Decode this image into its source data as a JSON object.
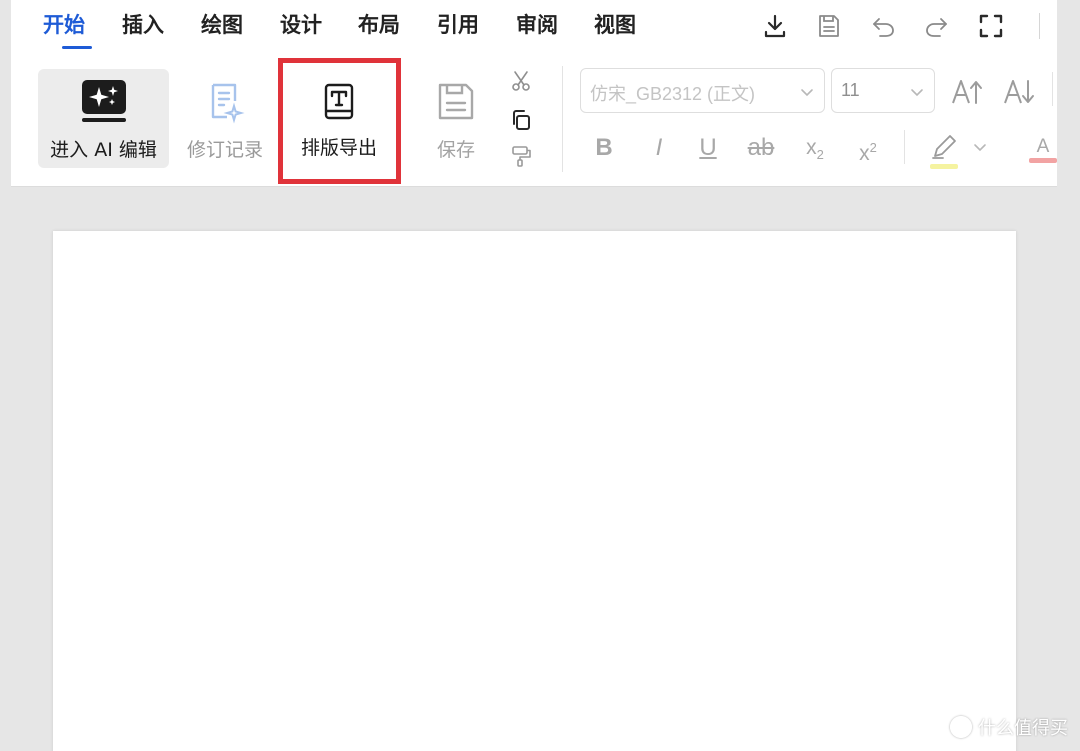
{
  "tabs": [
    {
      "label": "开始",
      "active": true
    },
    {
      "label": "插入"
    },
    {
      "label": "绘图"
    },
    {
      "label": "设计"
    },
    {
      "label": "布局"
    },
    {
      "label": "引用"
    },
    {
      "label": "审阅"
    },
    {
      "label": "视图"
    }
  ],
  "top_icons": [
    "download-icon",
    "save-file-icon",
    "undo-icon",
    "redo-icon",
    "fullscreen-icon"
  ],
  "ribbon": {
    "ai_edit_label": "进入 AI 编辑",
    "revision_label": "修订记录",
    "layout_export_label": "排版导出",
    "save_label": "保存",
    "clipboard_icons": [
      "scissors-icon",
      "copy-icon",
      "format-painter-icon"
    ],
    "font_family": "仿宋_GB2312 (正文)",
    "font_size": "11",
    "format_buttons": {
      "bold": "B",
      "italic": "I",
      "underline": "U",
      "strike": "ab",
      "subscript": "x",
      "subscript_index": "2",
      "superscript": "x",
      "superscript_index": "2",
      "font_color": "A"
    }
  },
  "colors": {
    "accent": "#1e5bd6",
    "highlight_box": "#e0333a",
    "highlighter": "#f5f3a0",
    "font_color_bar": "#f2a3a3"
  },
  "watermark": "什么值得买"
}
